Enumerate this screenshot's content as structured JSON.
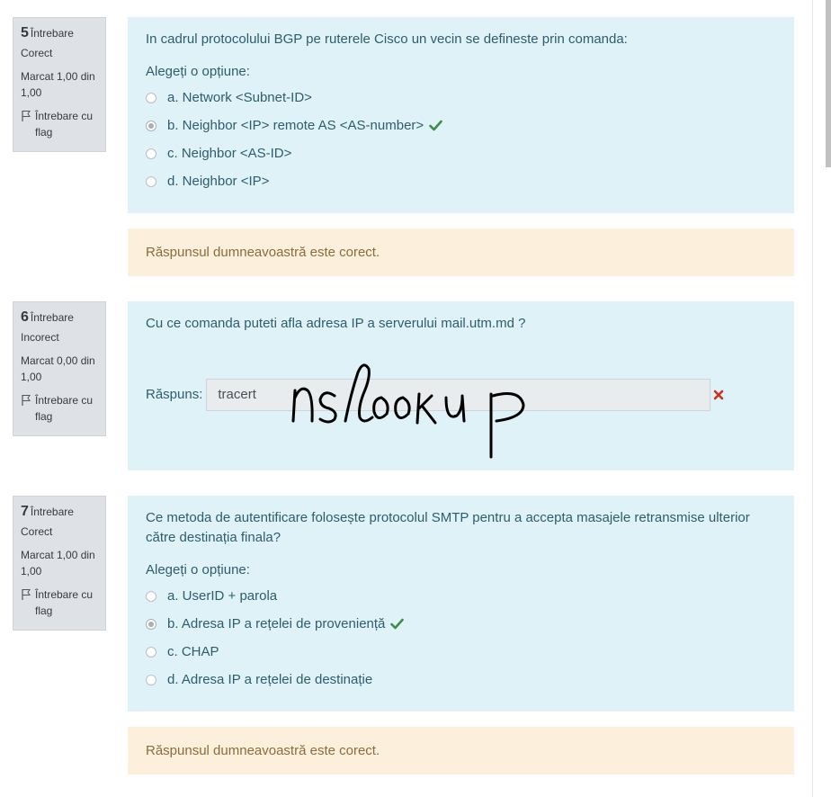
{
  "questions": [
    {
      "number": "5",
      "word": "Întrebare",
      "state": "Corect",
      "grade": "Marcat 1,00 din 1,00",
      "flag": "Întrebare cu flag",
      "text": "In cadrul protocolului BGP pe ruterele Cisco un vecin se defineste prin comanda:",
      "prompt": "Alegeți o opțiune:",
      "options": [
        {
          "label": "a. Network <Subnet-ID>",
          "checked": false,
          "correct": false
        },
        {
          "label": "b. Neighbor <IP> remote AS <AS-number>",
          "checked": true,
          "correct": true
        },
        {
          "label": "c. Neighbor <AS-ID>",
          "checked": false,
          "correct": false
        },
        {
          "label": "d. Neighbor <IP>",
          "checked": false,
          "correct": false
        }
      ],
      "feedback": "Răspunsul dumneavoastră este corect."
    },
    {
      "number": "6",
      "word": "Întrebare",
      "state": "Incorect",
      "grade": "Marcat 0,00 din 1,00",
      "flag": "Întrebare cu flag",
      "text": "Cu ce comanda puteti afla adresa IP a serverului mail.utm.md ?",
      "answer_label": "Răspuns:",
      "answer_value": "tracert",
      "handwritten_annotation": "nslookup"
    },
    {
      "number": "7",
      "word": "Întrebare",
      "state": "Corect",
      "grade": "Marcat 1,00 din 1,00",
      "flag": "Întrebare cu flag",
      "text": "Ce metoda de autentificare folosește protocolul SMTP pentru a accepta masajele retransmise ulterior către destinația finala?",
      "prompt": "Alegeți o opțiune:",
      "options": [
        {
          "label": "a. UserID + parola",
          "checked": false,
          "correct": false
        },
        {
          "label": "b. Adresa IP a rețelei de proveniență",
          "checked": true,
          "correct": true
        },
        {
          "label": "c. CHAP",
          "checked": false,
          "correct": false
        },
        {
          "label": "d. Adresa IP a rețelei de destinație",
          "checked": false,
          "correct": false
        }
      ],
      "feedback": "Răspunsul dumneavoastră este corect."
    }
  ],
  "colors": {
    "info_bg": "#dee2e6",
    "formulation_bg": "#def2f8",
    "feedback_bg": "#fcefdc",
    "correct": "#3a8e45",
    "incorrect": "#ca3120"
  }
}
